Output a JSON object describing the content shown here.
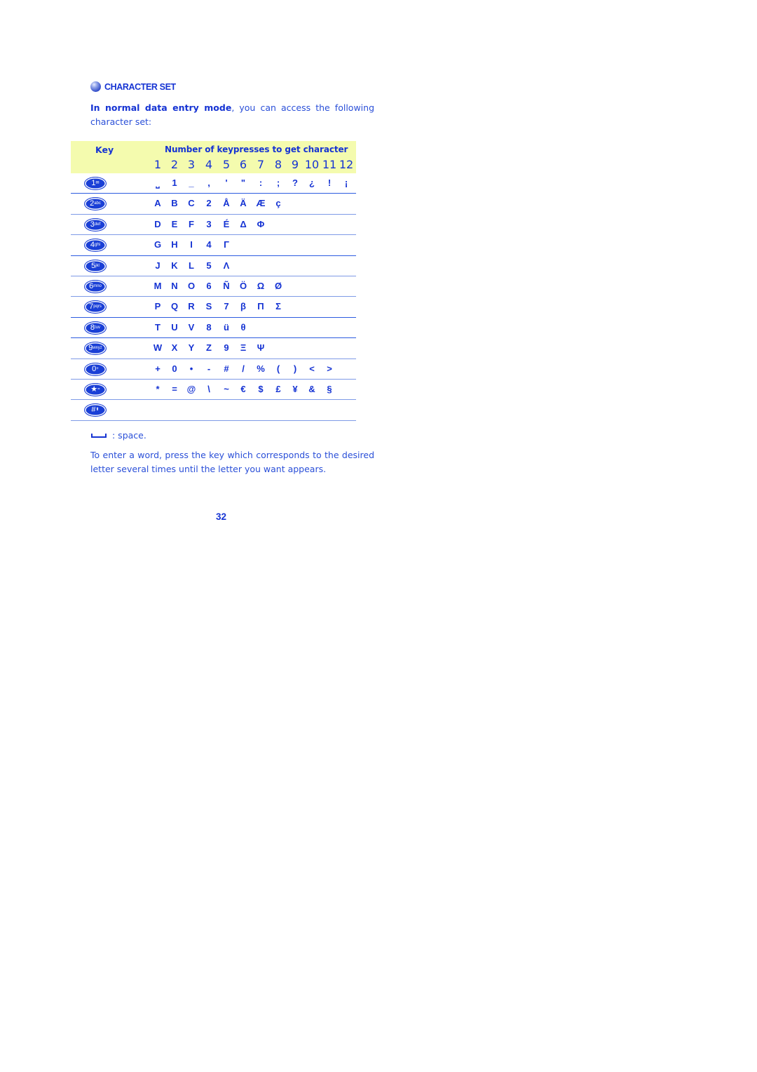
{
  "section": {
    "icon": "bullet-ball-icon",
    "title": "CHARACTER SET"
  },
  "intro": {
    "bold": "In normal data entry mode",
    "rest": ", you can access the following character set:"
  },
  "table": {
    "key_header": "Key",
    "presses_header": "Number of keypresses to get character",
    "columns": [
      "1",
      "2",
      "3",
      "4",
      "5",
      "6",
      "7",
      "8",
      "9",
      "10",
      "11",
      "12"
    ],
    "rows": [
      {
        "key": "1",
        "key_sub": "✉",
        "key_icon": "key-1-voicemail-icon",
        "chars": [
          "⎵",
          "1",
          "_",
          ",",
          "'",
          "\"",
          ":",
          ";",
          "?",
          "¿",
          "!",
          "¡"
        ]
      },
      {
        "key": "2",
        "key_sub": "abc",
        "key_icon": "key-2-icon",
        "chars": [
          "A",
          "B",
          "C",
          "2",
          "Å",
          "Ä",
          "Æ",
          "ç"
        ]
      },
      {
        "key": "3",
        "key_sub": "def",
        "key_icon": "key-3-icon",
        "chars": [
          "D",
          "E",
          "F",
          "3",
          "É",
          "Δ",
          "Φ"
        ]
      },
      {
        "key": "4",
        "key_sub": "ghi",
        "key_icon": "key-4-icon",
        "chars": [
          "G",
          "H",
          "I",
          "4",
          "Γ"
        ]
      },
      {
        "key": "5",
        "key_sub": "jkl",
        "key_icon": "key-5-icon",
        "chars": [
          "J",
          "K",
          "L",
          "5",
          "Λ"
        ]
      },
      {
        "key": "6",
        "key_sub": "mno",
        "key_icon": "key-6-icon",
        "chars": [
          "M",
          "N",
          "O",
          "6",
          "Ñ",
          "Ö",
          "Ω",
          "Ø"
        ]
      },
      {
        "key": "7",
        "key_sub": "pqrs",
        "key_icon": "key-7-icon",
        "chars": [
          "P",
          "Q",
          "R",
          "S",
          "7",
          "β",
          "Π",
          "Σ"
        ]
      },
      {
        "key": "8",
        "key_sub": "tuv",
        "key_icon": "key-8-icon",
        "chars": [
          "T",
          "U",
          "V",
          "8",
          "ü",
          "θ"
        ]
      },
      {
        "key": "9",
        "key_sub": "wxyz",
        "key_icon": "key-9-icon",
        "chars": [
          "W",
          "X",
          "Y",
          "Z",
          "9",
          "Ξ",
          "Ψ"
        ]
      },
      {
        "key": "0",
        "key_sub": "+",
        "key_icon": "key-0-icon",
        "chars": [
          "+",
          "0",
          "•",
          "-",
          "#",
          "/",
          "%",
          "(",
          ")",
          "<",
          ">"
        ]
      },
      {
        "key": "★",
        "key_sub": "=",
        "key_icon": "key-star-icon",
        "chars": [
          "*",
          "=",
          "@",
          "\\",
          "~",
          "€",
          "$",
          "£",
          "¥",
          "&",
          "§"
        ]
      },
      {
        "key": "#",
        "key_sub": "⬆",
        "key_icon": "key-hash-shift-icon",
        "chars": []
      }
    ]
  },
  "legend": {
    "icon": "space-symbol-icon",
    "text": ": space."
  },
  "outro": "To enter a word, press the key which corresponds to the desired letter several times until the letter you want appears.",
  "page_number": "32"
}
